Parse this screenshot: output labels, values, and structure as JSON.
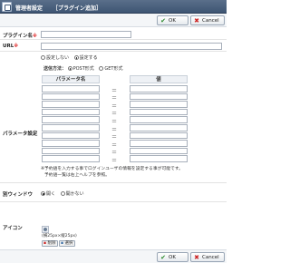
{
  "header": {
    "title": "管理者設定",
    "subtitle": "［プラグイン追加］"
  },
  "buttons": {
    "ok": "OK",
    "cancel": "Cancel"
  },
  "form": {
    "plugin_name": {
      "label": "プラグイン名",
      "required_mark": "※",
      "value": ""
    },
    "url": {
      "label": "URL",
      "required_mark": "※",
      "value": ""
    },
    "url_options": [
      "設定しない",
      "設定する"
    ],
    "url_selected": "設定する",
    "send_method": {
      "label": "送信方法：",
      "options": [
        "POST形式",
        "GET形式"
      ],
      "selected": "POST形式"
    },
    "params": {
      "label": "パラメータ設定",
      "col_name": "パラメータ名",
      "col_value": "値",
      "row_count": 10,
      "eq": "＝"
    },
    "params_note": [
      "※予約語を入力する事でログインユーザの情報を設定する事が可能です。",
      "予約語一覧は右上ヘルプを参照。"
    ],
    "window": {
      "label": "別ウィンドウ",
      "options": [
        "開く",
        "開かない"
      ],
      "selected": "開く"
    },
    "icon": {
      "label": "アイコン",
      "size_note": "(横25px×縦25px)",
      "delete": "削除",
      "choose": "選択"
    }
  }
}
